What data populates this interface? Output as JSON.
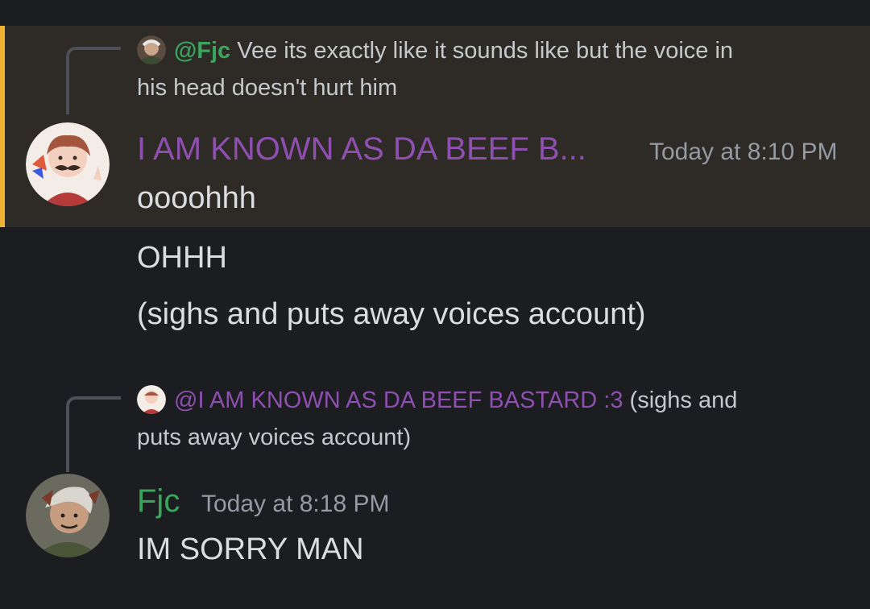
{
  "colors": {
    "background": "#1c1d21",
    "highlight_bg": "#2e2b27",
    "highlight_border": "#f0b232",
    "username_beef": "#8e4fb0",
    "username_fjc": "#3ba55d",
    "timestamp": "#949ba4",
    "text": "#dbdee1"
  },
  "messages": [
    {
      "reply": {
        "avatar_icon": "fjc-avatar-icon",
        "mention": "@Fjc",
        "text_line1": "Vee its exactly like it sounds like but the voice in",
        "text_line2": "his head doesn't hurt him"
      },
      "author": "I AM KNOWN AS DA BEEF B...",
      "timestamp": "Today at 8:10 PM",
      "lines": [
        "ooooh­hh",
        "OHHH",
        "(sighs and puts away voices account)"
      ]
    },
    {
      "reply": {
        "avatar_icon": "beef-avatar-icon",
        "mention": "@I AM KNOWN AS DA BEEF BASTARD :3",
        "text_line1": "(sighs and",
        "text_line2": "puts away voices account)"
      },
      "author": "Fjc",
      "timestamp": "Today at 8:18 PM",
      "lines": [
        "IM SORRY MAN"
      ]
    }
  ]
}
